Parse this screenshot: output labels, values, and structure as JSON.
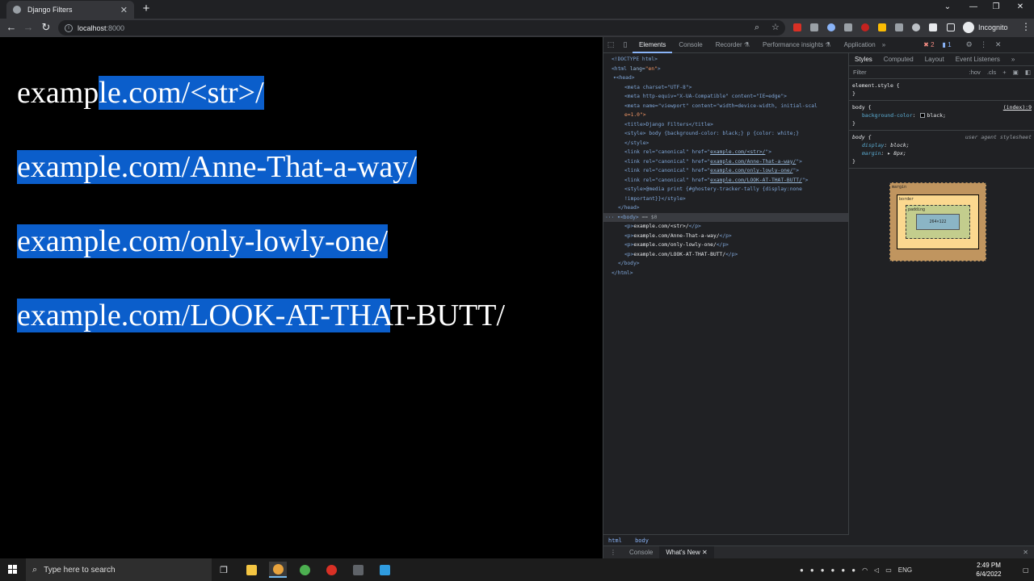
{
  "tab": {
    "title": "Django Filters",
    "close": "✕",
    "new_tab": "+"
  },
  "window_controls": {
    "dropdown": "⌄",
    "minimize": "—",
    "maximize": "❐",
    "close": "✕"
  },
  "address": {
    "host": "localhost",
    "port": ":8000"
  },
  "profile": {
    "label": "Incognito"
  },
  "page": {
    "line1_unselected": "examp",
    "line1_selected": "le.com/<str>/ ",
    "line2_selected": "example.com/Anne-That-a-way/ ",
    "line3_selected": "example.com/only-lowly-one/ ",
    "line4_selected": "example.com/LOOK-AT-THA",
    "line4_unselected": "T-BUTT/"
  },
  "devtools": {
    "tabs": [
      "Elements",
      "Console",
      "Recorder ⚗",
      "Performance insights ⚗",
      "Application"
    ],
    "more": "»",
    "errors": "✖ 2",
    "messages": "▮ 1",
    "dom": {
      "doctype": "<!DOCTYPE html>",
      "html_open_tag": "<html",
      "html_lang_attr": " lang=",
      "html_lang_val": "\"en\"",
      "head_open": "▾<head>",
      "meta_charset": "<meta charset=\"UTF-8\">",
      "meta_http": "<meta http-equiv=\"X-UA-Compatible\" content=\"IE=edge\">",
      "meta_viewport": "<meta name=\"viewport\" content=\"width=device-width, initial-scal",
      "meta_viewport_cont": "e=1.0\">",
      "title": "<title>Django Filters</title>",
      "style_open": "<style> body {background-color: black;} p {color: white;}",
      "style_close": "</style>",
      "link_prefix": "<link rel=\"canonical\" href=\"",
      "links": [
        "example.com/<str>/",
        "example.com/Anne-That-a-way/",
        "example.com/only-lowly-one/",
        "example.com/LOOK-AT-THAT-BUTT/"
      ],
      "link_suffix": "\">",
      "style2_a": "<style>@media print {#ghostery-tracker-tally {display:none",
      "style2_b": "!important}}</style>",
      "head_close": "</head>",
      "body_open": "··· ▾<body>",
      "body_eq": " == $0",
      "paras": [
        "example.com/<str>/",
        "example.com/Anne-That-a-way/",
        "example.com/only-lowly-one/",
        "example.com/LOOK-AT-THAT-BUTT/"
      ],
      "p_open": "<p>",
      "p_close": "</p>",
      "body_close": "</body>",
      "html_close": "</html>"
    },
    "breadcrumbs": [
      "html",
      "body"
    ],
    "styles": {
      "tabs": [
        "Styles",
        "Computed",
        "Layout",
        "Event Listeners"
      ],
      "more": "»",
      "filter_placeholder": "Filter",
      "hov": ":hov",
      "cls": ".cls",
      "element_style": "element.style {",
      "close_brace": "}",
      "body_selector": "body {",
      "body_source": "(index):9",
      "bg_prop": "background-color",
      "bg_val": "black;",
      "ua_selector": "body {",
      "ua_source": "user agent stylesheet",
      "display_prop": "display",
      "display_val": "block;",
      "margin_prop": "margin",
      "margin_val": "▸ 8px;"
    },
    "boxmodel": {
      "margin": "margin",
      "border": "border",
      "padding": "padding",
      "content": "264×122",
      "dash": "–"
    },
    "drawer": {
      "console": "Console",
      "whats_new": "What's New ✕"
    }
  },
  "taskbar": {
    "search_placeholder": "Type here to search",
    "lang": "ENG",
    "time": "2:49 PM",
    "date": "6/4/2022"
  },
  "colors": {
    "selection": "#0b5ecb",
    "page_bg": "#000000",
    "devtools_bg": "#202124"
  }
}
